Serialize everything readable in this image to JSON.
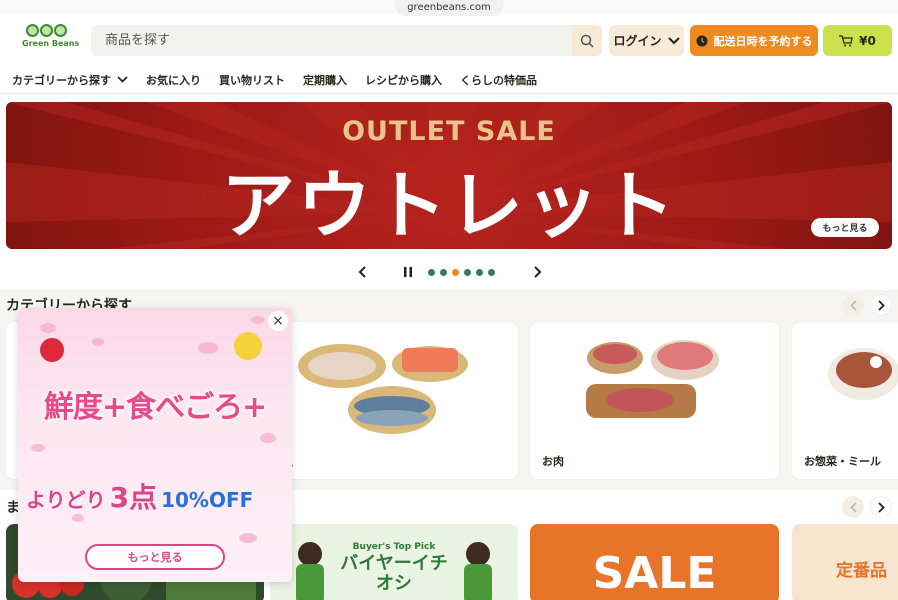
{
  "browser": {
    "url": "greenbeans.com"
  },
  "header": {
    "logo_text": "Green Beans",
    "search_placeholder": "商品を探す",
    "login_label": "ログイン",
    "reserve_label": "配送日時を予約する",
    "cart_label": "¥0"
  },
  "nav": {
    "items": [
      "カテゴリーから探す",
      "お気に入り",
      "買い物リスト",
      "定期購入",
      "レシピから購入",
      "くらしの特価品"
    ]
  },
  "hero": {
    "subtitle": "OUTLET SALE",
    "title": "アウトレット",
    "more_label": "もっと見る",
    "slide_count": 6,
    "active_slide": 3
  },
  "category_section": {
    "title": "カテゴリーから探す",
    "cards": [
      {
        "label": "魚"
      },
      {
        "label": "お肉"
      },
      {
        "label": "お惣菜・ミール"
      }
    ]
  },
  "feature_section": {
    "title": "ま",
    "cards": [
      {
        "label": "Buyer's Top Pick",
        "title": "バイヤーイチオシ"
      },
      {
        "label": "SALE"
      },
      {
        "label": "定番品"
      }
    ]
  },
  "popup": {
    "headline": "鮮度+食べごろ+",
    "deal_text1": "よりどり",
    "deal_text2": "3点",
    "deal_text3": "10%OFF",
    "more_label": "もっと見る",
    "close_label": "×"
  },
  "colors": {
    "brand_green": "#3b8f2e",
    "accent_orange": "#f08a1f",
    "cart_lime": "#cbe04a",
    "hero_red": "#9c1915",
    "popup_pink": "#e64b8a"
  }
}
